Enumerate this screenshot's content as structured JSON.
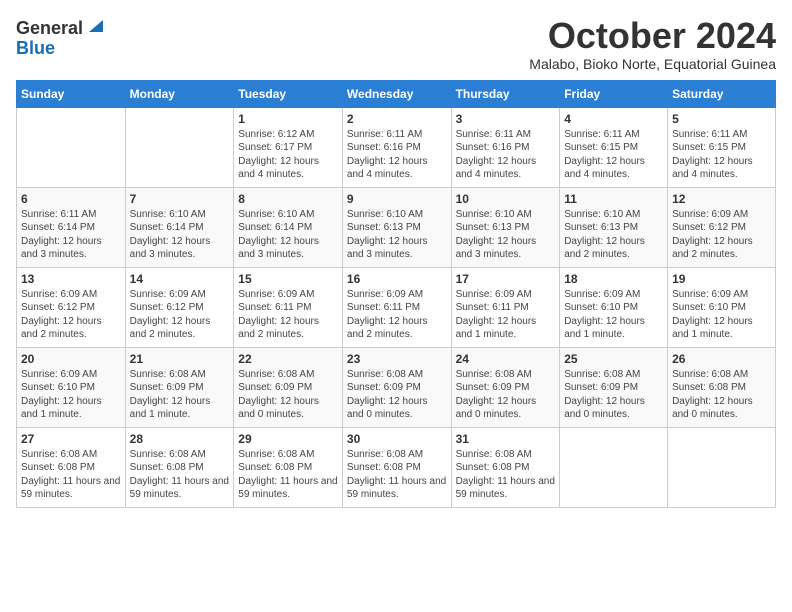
{
  "header": {
    "logo_general": "General",
    "logo_blue": "Blue",
    "month_title": "October 2024",
    "subtitle": "Malabo, Bioko Norte, Equatorial Guinea"
  },
  "weekdays": [
    "Sunday",
    "Monday",
    "Tuesday",
    "Wednesday",
    "Thursday",
    "Friday",
    "Saturday"
  ],
  "weeks": [
    [
      {
        "day": "",
        "info": ""
      },
      {
        "day": "",
        "info": ""
      },
      {
        "day": "1",
        "info": "Sunrise: 6:12 AM\nSunset: 6:17 PM\nDaylight: 12 hours and 4 minutes."
      },
      {
        "day": "2",
        "info": "Sunrise: 6:11 AM\nSunset: 6:16 PM\nDaylight: 12 hours and 4 minutes."
      },
      {
        "day": "3",
        "info": "Sunrise: 6:11 AM\nSunset: 6:16 PM\nDaylight: 12 hours and 4 minutes."
      },
      {
        "day": "4",
        "info": "Sunrise: 6:11 AM\nSunset: 6:15 PM\nDaylight: 12 hours and 4 minutes."
      },
      {
        "day": "5",
        "info": "Sunrise: 6:11 AM\nSunset: 6:15 PM\nDaylight: 12 hours and 4 minutes."
      }
    ],
    [
      {
        "day": "6",
        "info": "Sunrise: 6:11 AM\nSunset: 6:14 PM\nDaylight: 12 hours and 3 minutes."
      },
      {
        "day": "7",
        "info": "Sunrise: 6:10 AM\nSunset: 6:14 PM\nDaylight: 12 hours and 3 minutes."
      },
      {
        "day": "8",
        "info": "Sunrise: 6:10 AM\nSunset: 6:14 PM\nDaylight: 12 hours and 3 minutes."
      },
      {
        "day": "9",
        "info": "Sunrise: 6:10 AM\nSunset: 6:13 PM\nDaylight: 12 hours and 3 minutes."
      },
      {
        "day": "10",
        "info": "Sunrise: 6:10 AM\nSunset: 6:13 PM\nDaylight: 12 hours and 3 minutes."
      },
      {
        "day": "11",
        "info": "Sunrise: 6:10 AM\nSunset: 6:13 PM\nDaylight: 12 hours and 2 minutes."
      },
      {
        "day": "12",
        "info": "Sunrise: 6:09 AM\nSunset: 6:12 PM\nDaylight: 12 hours and 2 minutes."
      }
    ],
    [
      {
        "day": "13",
        "info": "Sunrise: 6:09 AM\nSunset: 6:12 PM\nDaylight: 12 hours and 2 minutes."
      },
      {
        "day": "14",
        "info": "Sunrise: 6:09 AM\nSunset: 6:12 PM\nDaylight: 12 hours and 2 minutes."
      },
      {
        "day": "15",
        "info": "Sunrise: 6:09 AM\nSunset: 6:11 PM\nDaylight: 12 hours and 2 minutes."
      },
      {
        "day": "16",
        "info": "Sunrise: 6:09 AM\nSunset: 6:11 PM\nDaylight: 12 hours and 2 minutes."
      },
      {
        "day": "17",
        "info": "Sunrise: 6:09 AM\nSunset: 6:11 PM\nDaylight: 12 hours and 1 minute."
      },
      {
        "day": "18",
        "info": "Sunrise: 6:09 AM\nSunset: 6:10 PM\nDaylight: 12 hours and 1 minute."
      },
      {
        "day": "19",
        "info": "Sunrise: 6:09 AM\nSunset: 6:10 PM\nDaylight: 12 hours and 1 minute."
      }
    ],
    [
      {
        "day": "20",
        "info": "Sunrise: 6:09 AM\nSunset: 6:10 PM\nDaylight: 12 hours and 1 minute."
      },
      {
        "day": "21",
        "info": "Sunrise: 6:08 AM\nSunset: 6:09 PM\nDaylight: 12 hours and 1 minute."
      },
      {
        "day": "22",
        "info": "Sunrise: 6:08 AM\nSunset: 6:09 PM\nDaylight: 12 hours and 0 minutes."
      },
      {
        "day": "23",
        "info": "Sunrise: 6:08 AM\nSunset: 6:09 PM\nDaylight: 12 hours and 0 minutes."
      },
      {
        "day": "24",
        "info": "Sunrise: 6:08 AM\nSunset: 6:09 PM\nDaylight: 12 hours and 0 minutes."
      },
      {
        "day": "25",
        "info": "Sunrise: 6:08 AM\nSunset: 6:09 PM\nDaylight: 12 hours and 0 minutes."
      },
      {
        "day": "26",
        "info": "Sunrise: 6:08 AM\nSunset: 6:08 PM\nDaylight: 12 hours and 0 minutes."
      }
    ],
    [
      {
        "day": "27",
        "info": "Sunrise: 6:08 AM\nSunset: 6:08 PM\nDaylight: 11 hours and 59 minutes."
      },
      {
        "day": "28",
        "info": "Sunrise: 6:08 AM\nSunset: 6:08 PM\nDaylight: 11 hours and 59 minutes."
      },
      {
        "day": "29",
        "info": "Sunrise: 6:08 AM\nSunset: 6:08 PM\nDaylight: 11 hours and 59 minutes."
      },
      {
        "day": "30",
        "info": "Sunrise: 6:08 AM\nSunset: 6:08 PM\nDaylight: 11 hours and 59 minutes."
      },
      {
        "day": "31",
        "info": "Sunrise: 6:08 AM\nSunset: 6:08 PM\nDaylight: 11 hours and 59 minutes."
      },
      {
        "day": "",
        "info": ""
      },
      {
        "day": "",
        "info": ""
      }
    ]
  ]
}
